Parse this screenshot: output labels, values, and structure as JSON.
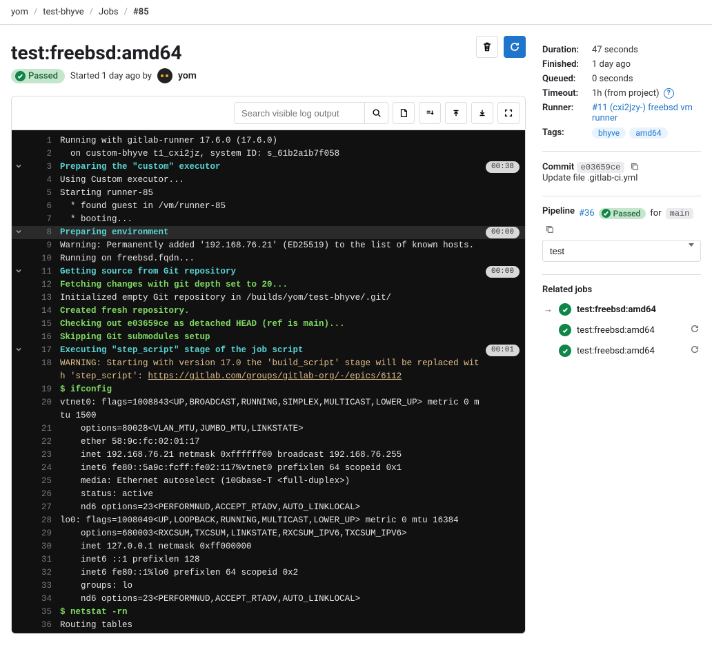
{
  "breadcrumbs": [
    "yom",
    "test-bhyve",
    "Jobs",
    "#85"
  ],
  "title": "test:freebsd:amd64",
  "status_label": "Passed",
  "started_text": "Started 1 day ago by",
  "author": "yom",
  "search": {
    "placeholder": "Search visible log output"
  },
  "log": {
    "lines": [
      {
        "n": 1,
        "t": "Running with gitlab-runner 17.6.0 (17.6.0)"
      },
      {
        "n": 2,
        "t": "  on custom-bhyve t1_cxi2jz, system ID: s_61b2a1b7f058"
      },
      {
        "n": 3,
        "t": "Preparing the \"custom\" executor",
        "cls": "teal",
        "toggle": true,
        "time": "00:38"
      },
      {
        "n": 4,
        "t": "Using Custom executor..."
      },
      {
        "n": 5,
        "t": "Starting runner-85"
      },
      {
        "n": 6,
        "t": "  * found guest in /vm/runner-85"
      },
      {
        "n": 7,
        "t": "  * booting..."
      },
      {
        "n": 8,
        "t": "Preparing environment",
        "cls": "teal",
        "toggle": true,
        "time": "00:00",
        "hover": true
      },
      {
        "n": 9,
        "t": "Warning: Permanently added '192.168.76.21' (ED25519) to the list of known hosts."
      },
      {
        "n": 10,
        "t": "Running on freebsd.fqdn..."
      },
      {
        "n": 11,
        "t": "Getting source from Git repository",
        "cls": "teal",
        "toggle": true,
        "time": "00:00"
      },
      {
        "n": 12,
        "t": "Fetching changes with git depth set to 20...",
        "cls": "green"
      },
      {
        "n": 13,
        "t": "Initialized empty Git repository in /builds/yom/test-bhyve/.git/"
      },
      {
        "n": 14,
        "t": "Created fresh repository.",
        "cls": "green"
      },
      {
        "n": 15,
        "t": "Checking out e03659ce as detached HEAD (ref is main)...",
        "cls": "green"
      },
      {
        "n": 16,
        "t": "Skipping Git submodules setup",
        "cls": "green"
      },
      {
        "n": 17,
        "t": "Executing \"step_script\" stage of the job script",
        "cls": "teal",
        "toggle": true,
        "time": "00:01"
      },
      {
        "n": 18,
        "t": "WARNING: Starting with version 17.0 the 'build_script' stage will be replaced with 'step_script': ",
        "cls": "yellow",
        "link": "https://gitlab.com/groups/gitlab-org/-/epics/6112"
      },
      {
        "n": 19,
        "t": "$ ifconfig",
        "cls": "green"
      },
      {
        "n": 20,
        "t": "vtnet0: flags=1008843<UP,BROADCAST,RUNNING,SIMPLEX,MULTICAST,LOWER_UP> metric 0 mtu 1500"
      },
      {
        "n": 21,
        "t": "    options=80028<VLAN_MTU,JUMBO_MTU,LINKSTATE>"
      },
      {
        "n": 22,
        "t": "    ether 58:9c:fc:02:01:17"
      },
      {
        "n": 23,
        "t": "    inet 192.168.76.21 netmask 0xffffff00 broadcast 192.168.76.255"
      },
      {
        "n": 24,
        "t": "    inet6 fe80::5a9c:fcff:fe02:117%vtnet0 prefixlen 64 scopeid 0x1"
      },
      {
        "n": 25,
        "t": "    media: Ethernet autoselect (10Gbase-T <full-duplex>)"
      },
      {
        "n": 26,
        "t": "    status: active"
      },
      {
        "n": 27,
        "t": "    nd6 options=23<PERFORMNUD,ACCEPT_RTADV,AUTO_LINKLOCAL>"
      },
      {
        "n": 28,
        "t": "lo0: flags=1008049<UP,LOOPBACK,RUNNING,MULTICAST,LOWER_UP> metric 0 mtu 16384"
      },
      {
        "n": 29,
        "t": "    options=680003<RXCSUM,TXCSUM,LINKSTATE,RXCSUM_IPV6,TXCSUM_IPV6>"
      },
      {
        "n": 30,
        "t": "    inet 127.0.0.1 netmask 0xff000000"
      },
      {
        "n": 31,
        "t": "    inet6 ::1 prefixlen 128"
      },
      {
        "n": 32,
        "t": "    inet6 fe80::1%lo0 prefixlen 64 scopeid 0x2"
      },
      {
        "n": 33,
        "t": "    groups: lo"
      },
      {
        "n": 34,
        "t": "    nd6 options=23<PERFORMNUD,ACCEPT_RTADV,AUTO_LINKLOCAL>"
      },
      {
        "n": 35,
        "t": "$ netstat -rn",
        "cls": "green"
      },
      {
        "n": 36,
        "t": "Routing tables"
      }
    ]
  },
  "details": {
    "duration_k": "Duration:",
    "duration_v": "47 seconds",
    "finished_k": "Finished:",
    "finished_v": "1 day ago",
    "queued_k": "Queued:",
    "queued_v": "0 seconds",
    "timeout_k": "Timeout:",
    "timeout_v": "1h (from project)",
    "runner_k": "Runner:",
    "runner_v": "#11 (cxi2jzy-) freebsd vm runner",
    "tags_k": "Tags:",
    "tags": [
      "bhyve",
      "amd64"
    ]
  },
  "commit": {
    "label": "Commit",
    "sha": "e03659ce",
    "message": "Update file .gitlab-ci.yml"
  },
  "pipeline": {
    "label": "Pipeline",
    "id": "#36",
    "status": "Passed",
    "for": "for",
    "branch": "main",
    "stage": "test"
  },
  "related": {
    "label": "Related jobs",
    "current": "test:freebsd:amd64",
    "items": [
      "test:freebsd:amd64",
      "test:freebsd:amd64"
    ]
  }
}
